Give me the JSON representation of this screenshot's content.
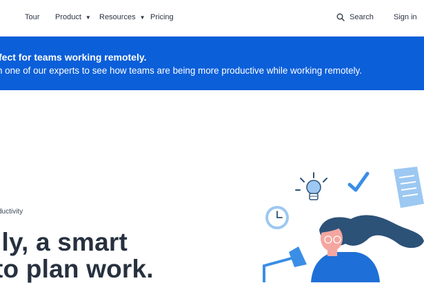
{
  "nav": {
    "items": [
      {
        "label": "Tour"
      },
      {
        "label": "Product"
      },
      {
        "label": "Resources"
      },
      {
        "label": "Pricing"
      }
    ],
    "search_label": "Search",
    "signin_label": "Sign in"
  },
  "banner": {
    "title": "fect for teams working remotely.",
    "subtitle": "n one of our experts to see how teams are being more productive while working remotely."
  },
  "hero": {
    "eyebrow": "ductivity",
    "headline_line1": "lly, a smart",
    "headline_line2": "to plan work."
  },
  "colors": {
    "banner": "#0b5fd9",
    "illustration_light_blue": "#9cc8f2",
    "illustration_mid_blue": "#3a8ee6",
    "illustration_dark_blue": "#2c5278",
    "illustration_skin": "#f4a6a0"
  },
  "icons": [
    "chevron-down-icon",
    "search-icon",
    "lightbulb-icon",
    "checkmark-icon",
    "document-icon",
    "clock-icon",
    "desk-lamp-icon"
  ]
}
